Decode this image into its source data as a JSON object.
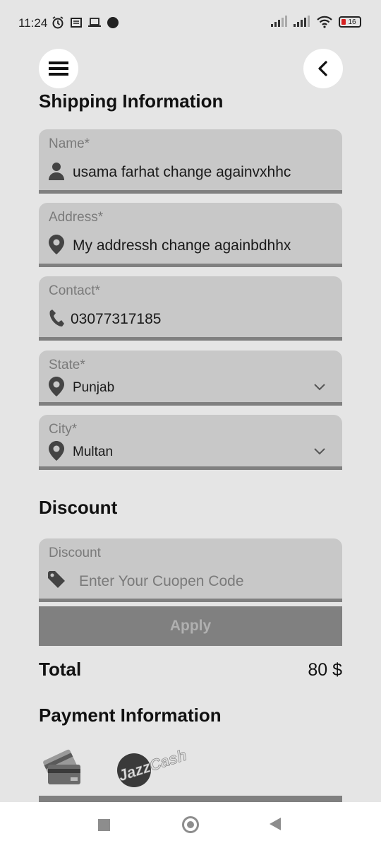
{
  "status_bar": {
    "time": "11:24",
    "battery": "16",
    "battery_color": "#d62020"
  },
  "header": {
    "menu_icon": "hamburger-menu-icon",
    "back_icon": "chevron-left-icon"
  },
  "shipping": {
    "title": "Shipping Information",
    "fields": [
      {
        "label": "Name*",
        "value": "usama farhat change againvxhhc",
        "icon": "person-icon"
      },
      {
        "label": "Address*",
        "value": "My addressh change againbdhhx",
        "icon": "location-pin-icon"
      },
      {
        "label": "Contact*",
        "value": "03077317185",
        "icon": "phone-icon"
      },
      {
        "label": "State*",
        "value": "Punjab",
        "icon": "location-pin-icon"
      },
      {
        "label": "City*",
        "value": "Multan",
        "icon": "location-pin-icon"
      }
    ]
  },
  "discount": {
    "title": "Discount",
    "label": "Discount",
    "placeholder": "Enter Your Cuopen Code",
    "icon": "tag-icon",
    "apply_label": "Apply"
  },
  "total": {
    "label": "Total",
    "value": "80 $"
  },
  "payment": {
    "title": "Payment Information",
    "methods": [
      "credit-card-icon",
      "jazzcash-logo"
    ],
    "jazzcash_logo_text": "JazzCash"
  },
  "colors": {
    "background": "#e5e5e5",
    "field_bg": "#c8c8c8",
    "underline": "#808080",
    "button": "#808080"
  }
}
